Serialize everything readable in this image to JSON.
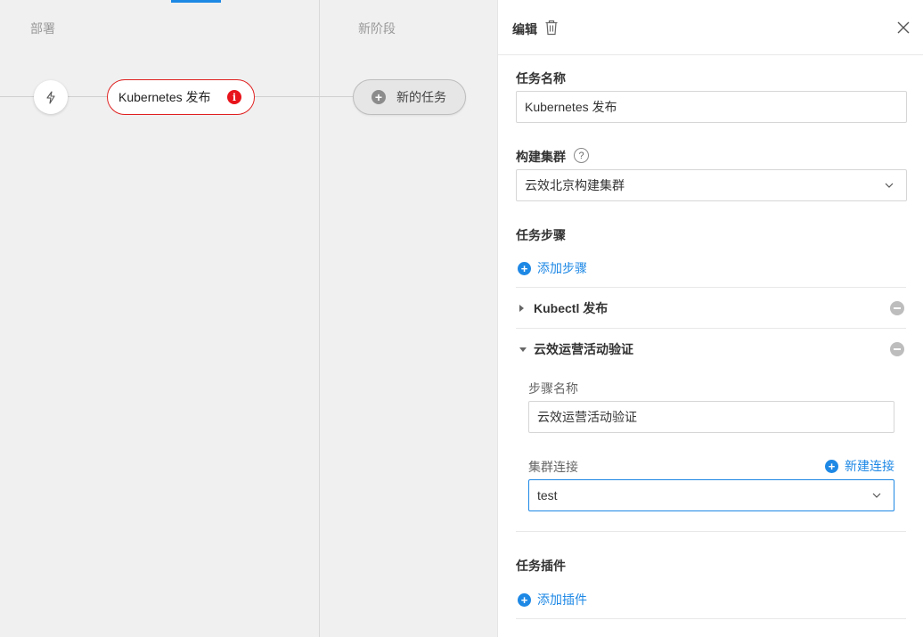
{
  "canvas": {
    "stages": [
      {
        "title": "部署"
      },
      {
        "title": "新阶段"
      }
    ],
    "task_node": {
      "label": "Kubernetes 发布",
      "error_glyph": "i"
    },
    "new_task": {
      "label": "新的任务"
    }
  },
  "panel": {
    "title": "编辑",
    "task_name": {
      "label": "任务名称",
      "value": "Kubernetes 发布"
    },
    "build_cluster": {
      "label": "构建集群",
      "help_glyph": "?",
      "value": "云效北京构建集群"
    },
    "task_steps": {
      "label": "任务步骤",
      "add_label": "添加步骤",
      "steps": [
        {
          "title": "Kubectl 发布",
          "expanded": false
        },
        {
          "title": "云效运营活动验证",
          "expanded": true
        }
      ],
      "step_name": {
        "label": "步骤名称",
        "value": "云效运营活动验证"
      },
      "cluster_conn": {
        "label": "集群连接",
        "new_label": "新建连接",
        "value": "test"
      }
    },
    "task_plugins": {
      "label": "任务插件",
      "add_label": "添加插件"
    }
  },
  "colors": {
    "accent": "#1e88e5",
    "error": "#e8141b",
    "canvas_bg": "#f0f0f0"
  },
  "icons": [
    "lightning-icon",
    "error-icon",
    "plus-circle-icon",
    "trash-icon",
    "close-icon",
    "help-icon",
    "chevron-down-icon",
    "caret-right-icon",
    "caret-down-icon",
    "minus-circle-icon"
  ]
}
